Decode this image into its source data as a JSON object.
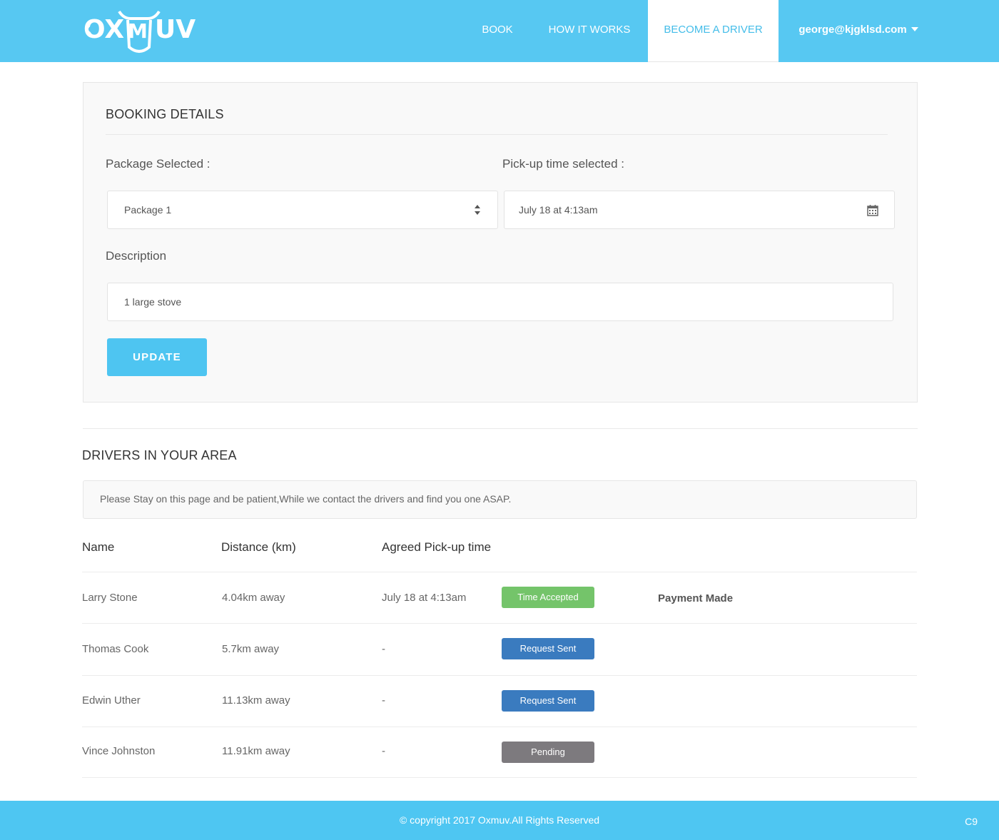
{
  "brand": {
    "name": "OXMUV",
    "logo_icon": "bull-head-logo-icon",
    "color": "#57c8f2"
  },
  "nav": {
    "book": "BOOK",
    "how_it_works": "HOW IT WORKS",
    "become_driver": "BECOME A DRIVER",
    "user_email": "george@kjgklsd.com"
  },
  "booking": {
    "title": "BOOKING DETAILS",
    "package_label": "Package Selected :",
    "package_value": "Package 1",
    "pickup_label": "Pick-up time selected :",
    "pickup_value": "July 18 at 4:13am",
    "description_label": "Description",
    "description_value": "1 large stove",
    "update_button": "UPDATE"
  },
  "drivers": {
    "title": "DRIVERS IN YOUR AREA",
    "notice": "Please Stay on this page and be patient,While we contact the drivers and find you one ASAP.",
    "columns": [
      "Name",
      "Distance (km)",
      "Agreed Pick-up time"
    ],
    "rows": [
      {
        "name": "Larry Stone",
        "distance": "4.04km away",
        "time": "July 18 at 4:13am",
        "status": "Time Accepted",
        "status_color": "#74c46a",
        "extra": "Payment Made"
      },
      {
        "name": "Thomas Cook",
        "distance": "5.7km away",
        "time": "-",
        "status": "Request Sent",
        "status_color": "#3a7bbf",
        "extra": ""
      },
      {
        "name": "Edwin Uther",
        "distance": "11.13km away",
        "time": "-",
        "status": "Request Sent",
        "status_color": "#3a7bbf",
        "extra": ""
      },
      {
        "name": "Vince Johnston",
        "distance": "11.91km away",
        "time": "-",
        "status": "Pending",
        "status_color": "#7d7a7e",
        "extra": ""
      }
    ]
  },
  "footer": {
    "copyright": "© copyright 2017 Oxmuv.All Rights Reserved",
    "version": "C9"
  }
}
